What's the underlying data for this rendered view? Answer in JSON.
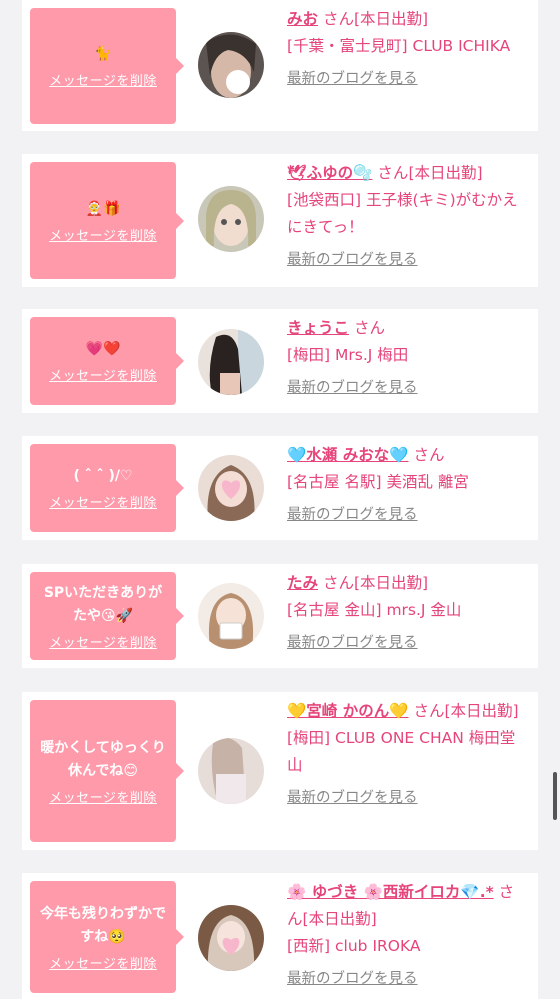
{
  "delete_label": "メッセージを削除",
  "blog_label": "最新のブログを見る",
  "san": "さん",
  "items": [
    {
      "message": "🐈",
      "name": "みお",
      "status": "[本日出勤]",
      "shop": "[千葉・富士見町] CLUB ICHIKA"
    },
    {
      "message": "🤶🎁",
      "name": "🕊ふゆの🫧",
      "status": "[本日出勤]",
      "shop": "[池袋西口] 王子様(キミ)がむかえにきてっ！"
    },
    {
      "message": "💗❤️",
      "name": "きょうこ",
      "status": "",
      "shop": "[梅田] Mrs.J 梅田"
    },
    {
      "message": "( ˆ ˆ )/♡",
      "name": "🩵水瀬 みおな🩵",
      "status": "",
      "shop": "[名古屋 名駅] 美酒乱 離宮"
    },
    {
      "message": "SPいただきありがたや😘🚀",
      "name": "たみ",
      "status": "[本日出勤]",
      "shop": "[名古屋 金山] mrs.J 金山"
    },
    {
      "message": "暖かくしてゆっくり休んでね😊",
      "name": "💛宮崎 かのん💛",
      "status": "[本日出勤]",
      "shop": "[梅田] CLUB ONE CHAN 梅田堂山"
    },
    {
      "message": "今年も残りわずかですね🥺",
      "name": "🌸 ゆづき 🌸西新イロカ💎.*",
      "status": "[本日出勤]",
      "shop": "[西新] club IROKA"
    }
  ]
}
